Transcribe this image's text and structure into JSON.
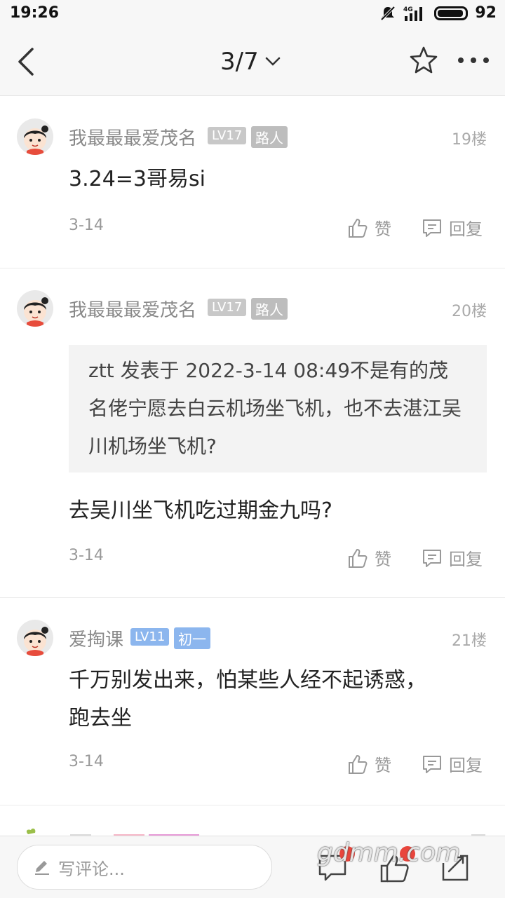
{
  "status": {
    "time": "19:26",
    "signal": "4G",
    "battery": "92"
  },
  "header": {
    "pager": "3/7"
  },
  "posts": [
    {
      "username": "我最最最爱茂名",
      "level": "LV17",
      "role": "路人",
      "floor": "19楼",
      "content": "3.24=3哥易si",
      "date": "3-14",
      "like_label": "赞",
      "reply_label": "回复"
    },
    {
      "username": "我最最最爱茂名",
      "level": "LV17",
      "role": "路人",
      "floor": "20楼",
      "quote": "ztt 发表于 2022-3-14 08:49不是有的茂名佬宁愿去白云机场坐飞机，也不去湛江吴川机场坐飞机?",
      "content": "去吴川坐飞机吃过期金九吗?",
      "date": "3-14",
      "like_label": "赞",
      "reply_label": "回复"
    },
    {
      "username": "爱掏课",
      "level": "LV11",
      "role": "初一",
      "floor": "21楼",
      "content": "千万别发出来，怕某些人经不起诱惑，跑去坐",
      "date": "3-14",
      "like_label": "赞",
      "reply_label": "回复"
    }
  ],
  "bottom": {
    "placeholder": "写评论...",
    "watermark": "gdmm.com"
  }
}
